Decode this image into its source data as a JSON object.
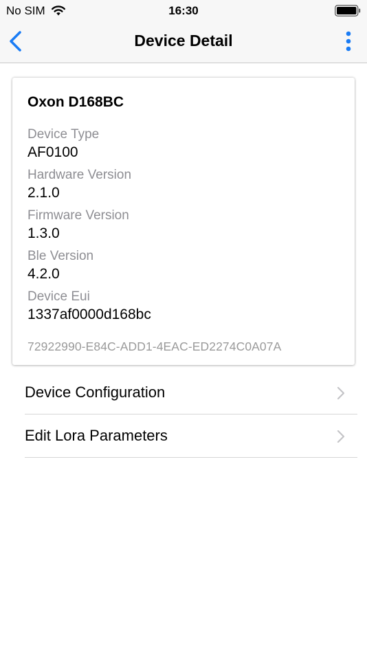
{
  "status_bar": {
    "carrier": "No SIM",
    "time": "16:30",
    "wifi_icon": "wifi-icon",
    "battery_icon": "battery-icon"
  },
  "nav": {
    "title": "Device Detail",
    "back_icon": "chevron-left-icon",
    "more_icon": "vertical-ellipsis-icon",
    "accent_color": "#1a7cf5"
  },
  "device": {
    "name": "Oxon D168BC",
    "fields": [
      {
        "label": "Device Type",
        "value": "AF0100"
      },
      {
        "label": "Hardware Version",
        "value": "2.1.0"
      },
      {
        "label": "Firmware Version",
        "value": "1.3.0"
      },
      {
        "label": "Ble Version",
        "value": "4.2.0"
      },
      {
        "label": "Device Eui",
        "value": "1337af0000d168bc"
      }
    ],
    "uuid": "72922990-E84C-ADD1-4EAC-ED2274C0A07A"
  },
  "menu": [
    {
      "label": "Device Configuration",
      "icon": "chevron-right-icon"
    },
    {
      "label": "Edit Lora Parameters",
      "icon": "chevron-right-icon"
    }
  ]
}
